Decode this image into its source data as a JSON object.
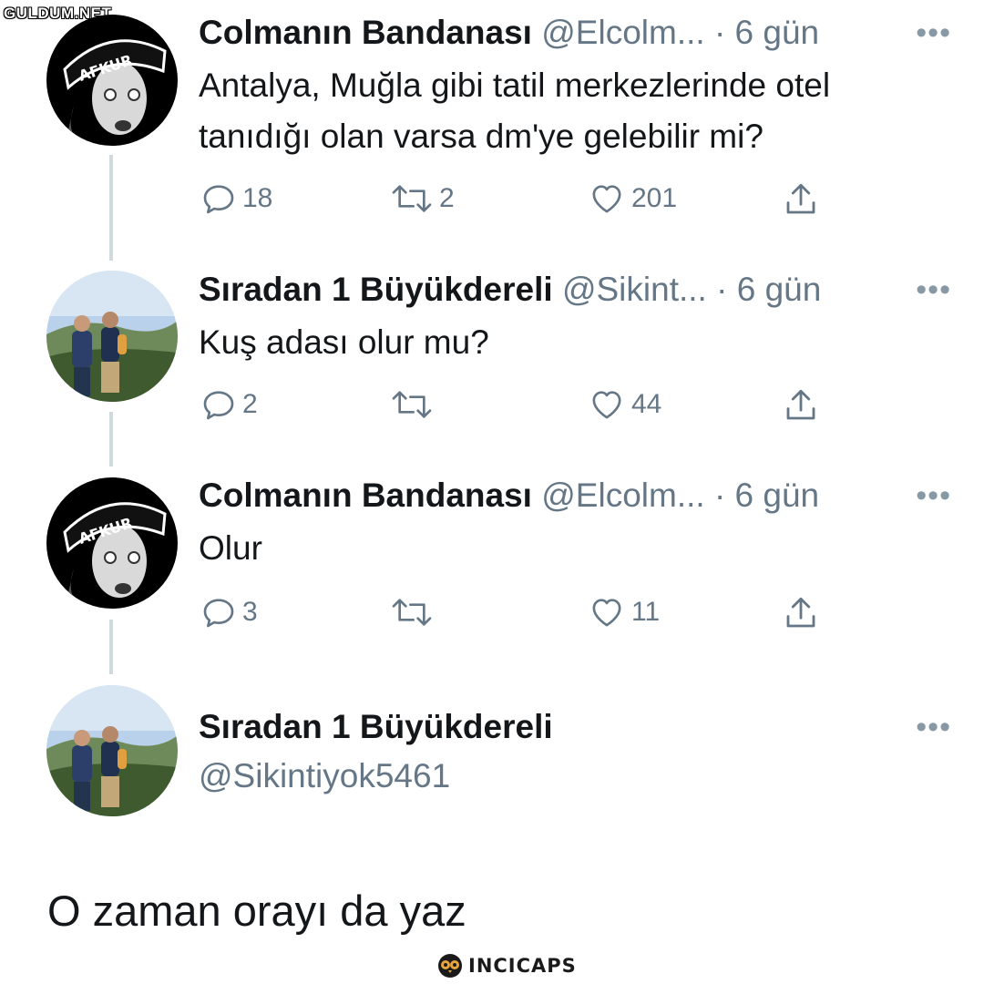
{
  "watermark": "GULDUM.NET",
  "thread": [
    {
      "author": "Colmanın Bandanası",
      "handle": "@Elcolm...",
      "separator": "·",
      "time": "6 gün",
      "text_lines": [
        "Antalya, Muğla gibi tatil merkezlerinde otel",
        "tanıdığı olan varsa dm'ye gelebilir mi?"
      ],
      "replies": "18",
      "retweets": "2",
      "likes": "201",
      "avatar": "afkur-bandana-avatar",
      "avatar_text": "AFKUR"
    },
    {
      "author": "Sıradan 1 Büyükdereli",
      "handle": "@Sikint...",
      "separator": "·",
      "time": "6 gün",
      "text_lines": [
        "Kuş adası olur mu?"
      ],
      "replies": "2",
      "retweets": "",
      "likes": "44",
      "avatar": "outdoor-photo-avatar"
    },
    {
      "author": "Colmanın Bandanası",
      "handle": "@Elcolm...",
      "separator": "·",
      "time": "6 gün",
      "text_lines": [
        "Olur"
      ],
      "replies": "3",
      "retweets": "",
      "likes": "11",
      "avatar": "afkur-bandana-avatar",
      "avatar_text": "AFKUR"
    }
  ],
  "main_tweet": {
    "author": "Sıradan 1 Büyükdereli",
    "handle": "@Sikintiyok5461",
    "text": "O zaman orayı da yaz",
    "avatar": "outdoor-photo-avatar"
  },
  "more_label": "•••",
  "footer_logo": "INCICAPS",
  "colors": {
    "text": "#14171a",
    "secondary": "#657786",
    "thread_line": "#cfd9de"
  }
}
